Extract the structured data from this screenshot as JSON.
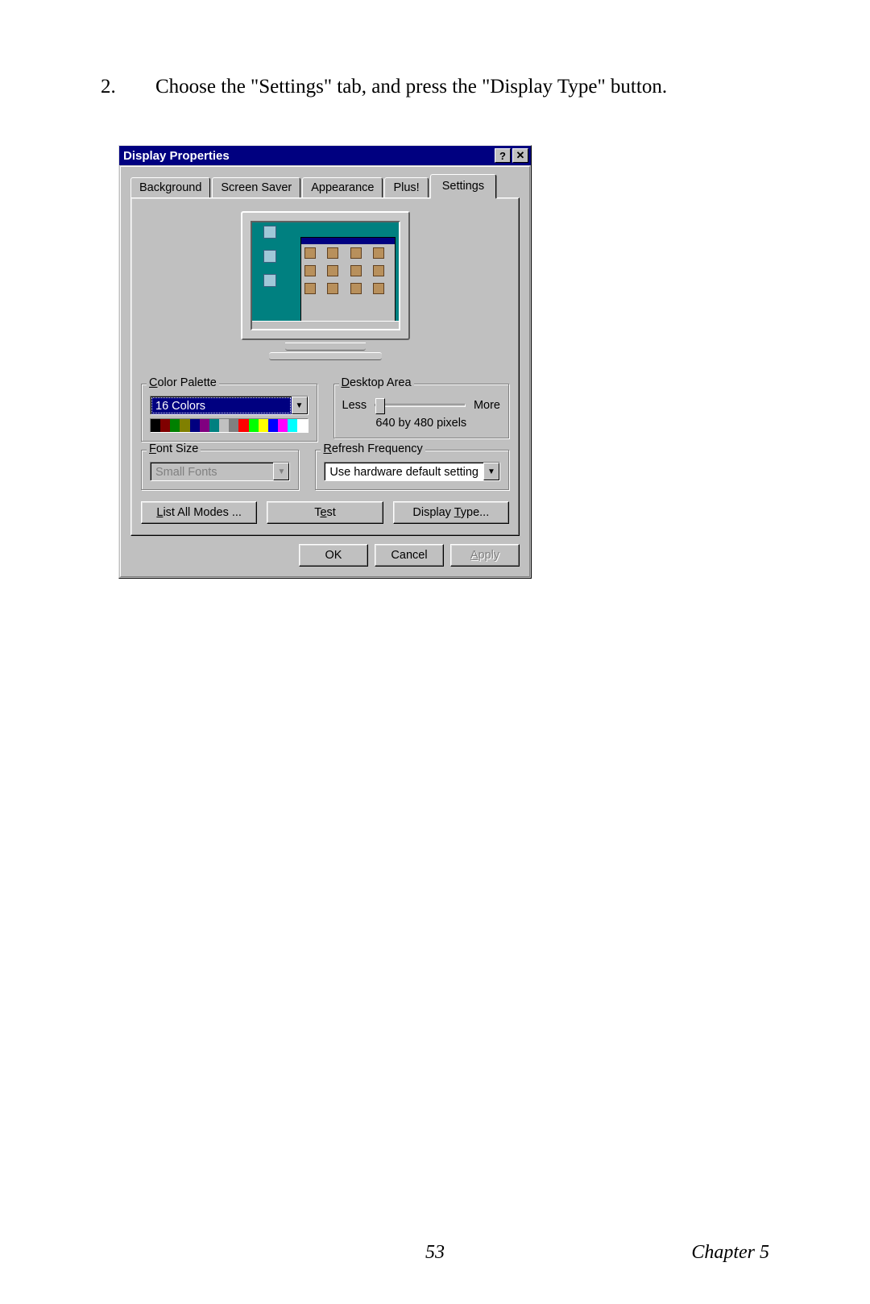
{
  "instruction": {
    "number": "2.",
    "text": "Choose the \"Settings\" tab, and press the \"Display Type\" button."
  },
  "dialog": {
    "title": "Display Properties",
    "help_glyph": "?",
    "close_glyph": "✕",
    "tabs": {
      "background": "Background",
      "screen_saver": "Screen Saver",
      "appearance": "Appearance",
      "plus": "Plus!",
      "settings": "Settings"
    },
    "color_palette": {
      "legend": "Color Palette",
      "value": "16 Colors",
      "colors": [
        "#000000",
        "#800000",
        "#008000",
        "#808000",
        "#000080",
        "#800080",
        "#008080",
        "#c0c0c0",
        "#808080",
        "#ff0000",
        "#00ff00",
        "#ffff00",
        "#0000ff",
        "#ff00ff",
        "#00ffff",
        "#ffffff"
      ]
    },
    "desktop_area": {
      "legend": "Desktop Area",
      "less": "Less",
      "more": "More",
      "resolution": "640 by 480 pixels"
    },
    "font_size": {
      "legend": "Font Size",
      "value": "Small Fonts"
    },
    "refresh": {
      "legend": "Refresh Frequency",
      "value": "Use hardware default setting"
    },
    "buttons": {
      "list_modes": "List All Modes ...",
      "test": "Test",
      "display_type": "Display Type...",
      "ok": "OK",
      "cancel": "Cancel",
      "apply": "Apply"
    }
  },
  "footer": {
    "page": "53",
    "chapter": "Chapter 5"
  }
}
